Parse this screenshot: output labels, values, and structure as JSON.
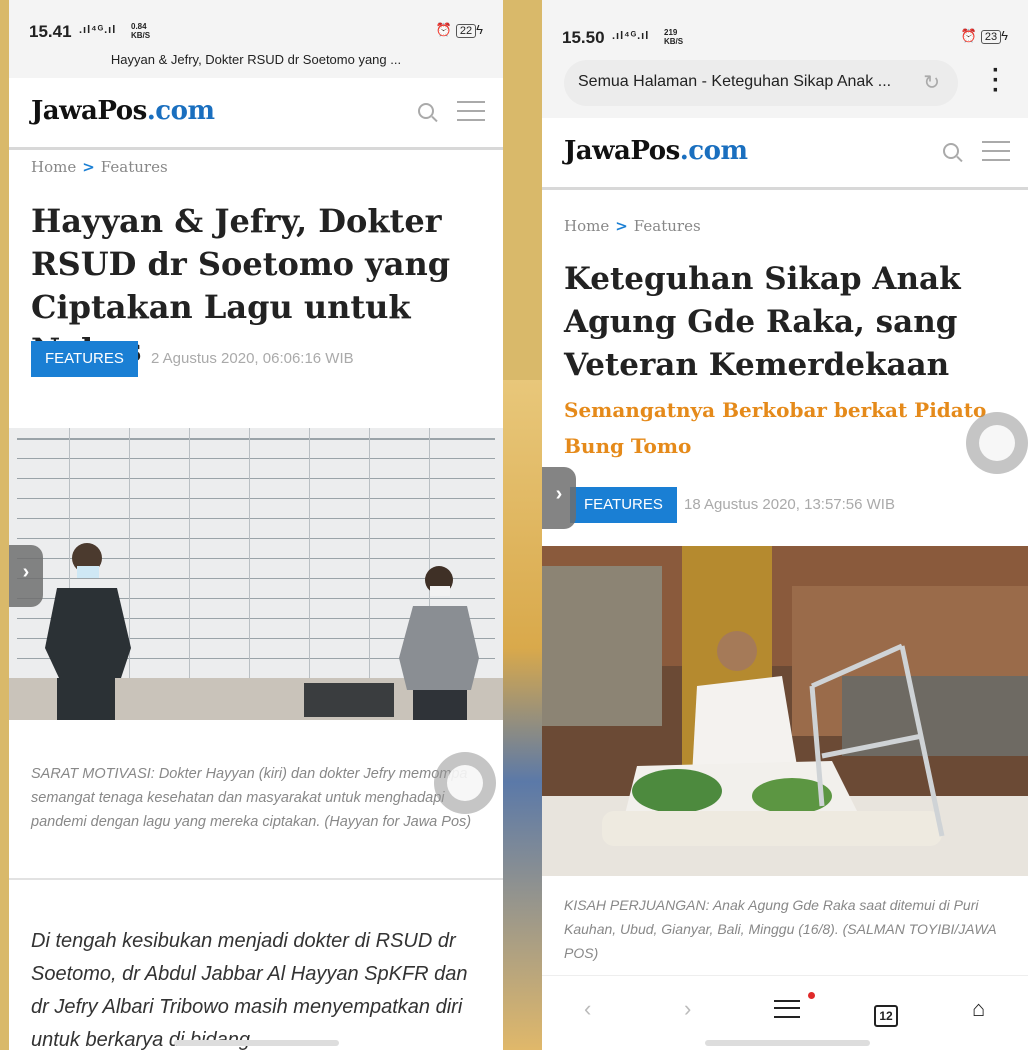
{
  "left": {
    "status": {
      "time": "15.41",
      "signal": ".ıl⁴ᴳ.ıl",
      "speed_value": "0.84",
      "speed_unit": "KB/S",
      "battery": "22"
    },
    "tab_title": "Hayyan & Jefry, Dokter RSUD dr Soetomo yang ...",
    "logo_main": "JawaPos",
    "logo_com": ".com",
    "breadcrumb": {
      "home": "Home",
      "arrow": ">",
      "section": "Features"
    },
    "headline": "Hayyan & Jefry, Dokter RSUD dr Soetomo yang Ciptakan Lagu untuk Nakes",
    "tag": "FEATURES",
    "date": "2 Agustus 2020, 06:06:16 WIB",
    "caption": "SARAT MOTIVASI: Dokter Hayyan (kiri) dan dokter Jefry memompa semangat tenaga kesehatan dan masyarakat untuk menghadapi pandemi dengan lagu yang mereka ciptakan. (Hayyan for Jawa Pos)",
    "body": "Di tengah kesibukan menjadi dokter di RSUD dr Soetomo, dr Abdul Jabbar Al Hayyan SpKFR dan dr Jefry Albari Tribowo masih menyempatkan diri untuk berkarya di bidang"
  },
  "right": {
    "status": {
      "time": "15.50",
      "signal": ".ıl⁴ᴳ.ıl",
      "speed_value": "219",
      "speed_unit": "KB/S",
      "battery": "23"
    },
    "url": "Semua Halaman - Keteguhan Sikap Anak ...",
    "logo_main": "JawaPos",
    "logo_com": ".com",
    "breadcrumb": {
      "home": "Home",
      "arrow": ">",
      "section": "Features"
    },
    "headline": "Keteguhan Sikap Anak Agung Gde Raka, sang Veteran Kemerdekaan",
    "subheadline": "Semangatnya Berkobar berkat Pidato Bung Tomo",
    "tag": "FEATURES",
    "date": "18 Agustus 2020, 13:57:56 WIB",
    "caption": "KISAH PERJUANGAN: Anak Agung Gde Raka saat ditemui di Puri Kauhan, Ubud, Gianyar, Bali, Minggu (16/8). (SALMAN TOYIBI/JAWA POS)",
    "nav": {
      "back": "‹",
      "forward": "›",
      "tabs_count": "12"
    }
  },
  "colors": {
    "brand_blue": "#1a7fd4",
    "subhead_orange": "#e58a1a"
  }
}
